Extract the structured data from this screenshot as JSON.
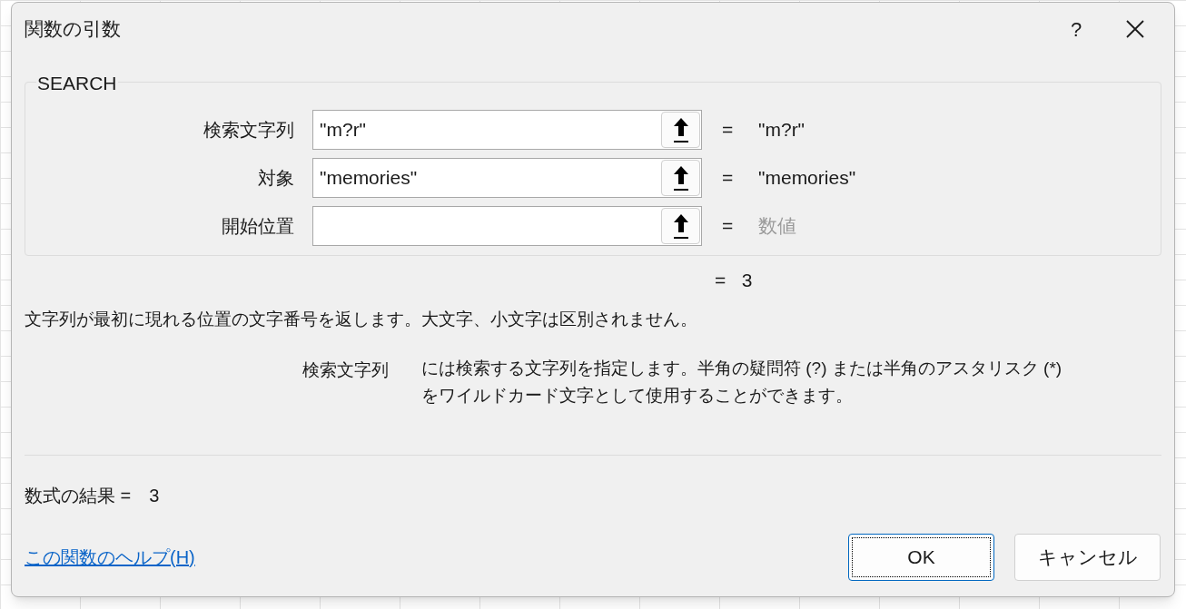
{
  "window": {
    "title": "関数の引数",
    "help_button": "?"
  },
  "function_group": {
    "name": "SEARCH",
    "arguments": [
      {
        "label": "検索文字列",
        "value": "\"m?r\"",
        "equals": "=",
        "result": "\"m?r\"",
        "result_dimmed": false
      },
      {
        "label": "対象",
        "value": "\"memories\"",
        "equals": "=",
        "result": "\"memories\"",
        "result_dimmed": false
      },
      {
        "label": "開始位置",
        "equals": "=",
        "result": "数値",
        "result_dimmed": true
      }
    ]
  },
  "function_result": "= 3",
  "description": "文字列が最初に現れる位置の文字番号を返します。大文字、小文字は区別されません。",
  "argument_help": {
    "label": "検索文字列",
    "text": "には検索する文字列を指定します。半角の疑問符 (?) または半角のアスタリスク (*) をワイルドカード文字として使用することができます。"
  },
  "formula_result": {
    "label": "数式の結果 =",
    "value": "3"
  },
  "help_link": "この関数のヘルプ(H)",
  "buttons": [
    {
      "label": "OK",
      "focused": true
    },
    {
      "label": "キャンセル",
      "focused": false
    }
  ]
}
